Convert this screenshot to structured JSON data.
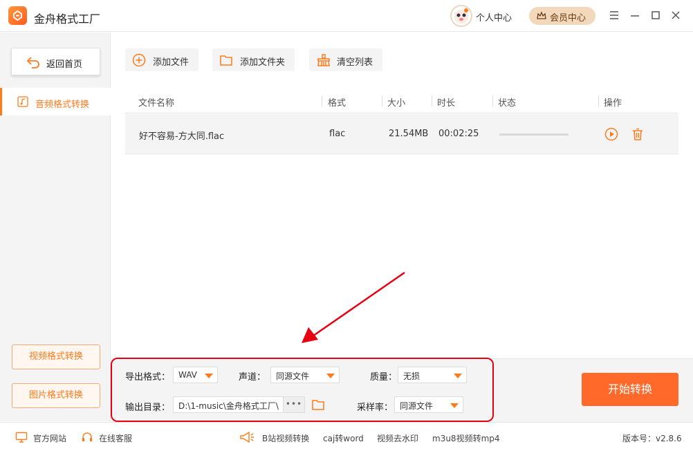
{
  "app": {
    "title": "金舟格式工厂"
  },
  "header": {
    "user_center": "个人中心",
    "vip_center": "会员中心"
  },
  "sidebar": {
    "back_home": "返回首页",
    "active_item": "音频格式转换",
    "video_convert": "视频格式转换",
    "image_convert": "图片格式转换"
  },
  "toolbar": {
    "add_file": "添加文件",
    "add_folder": "添加文件夹",
    "clear_list": "清空列表"
  },
  "table": {
    "columns": [
      "文件名称",
      "格式",
      "大小",
      "时长",
      "状态",
      "操作"
    ],
    "rows": [
      {
        "name": "好不容易-方大同.flac",
        "format": "flac",
        "size": "21.54MB",
        "duration": "00:02:25",
        "progress": 0
      }
    ]
  },
  "settings": {
    "export_format_label": "导出格式：",
    "export_format_value": "WAV",
    "channel_label": "声道：",
    "channel_value": "同源文件",
    "quality_label": "质量：",
    "quality_value": "无损",
    "output_dir_label": "输出目录：",
    "output_dir_value": "D:\\1-music\\金舟格式工厂\\",
    "browse_label": "•••",
    "sample_rate_label": "采样率：",
    "sample_rate_value": "同源文件",
    "start_button": "开始转换"
  },
  "footer": {
    "website": "官方网站",
    "support": "在线客服",
    "links": [
      "B站视频转换",
      "caj转word",
      "视频去水印",
      "m3u8视频转mp4"
    ],
    "version": "版本号：v2.8.6"
  },
  "colors": {
    "accent": "#ff7a1a",
    "start": "#ff6a2a",
    "annotation": "#e60012"
  }
}
